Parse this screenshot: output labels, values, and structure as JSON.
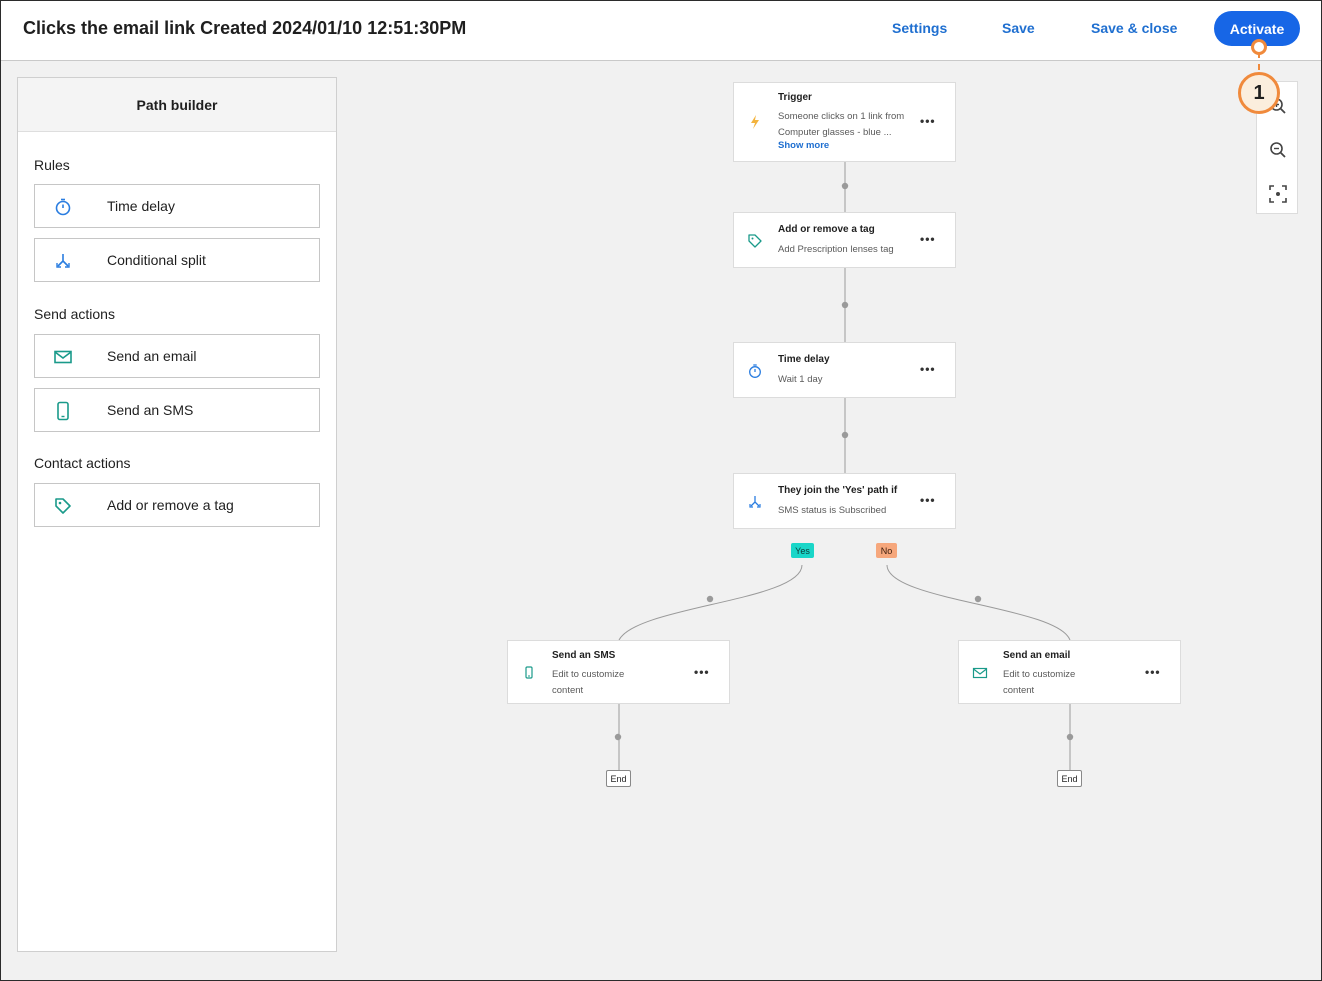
{
  "header": {
    "title": "Clicks the email link Created 2024/01/10 12:51:30PM",
    "settings_label": "Settings",
    "save_label": "Save",
    "save_close_label": "Save & close",
    "activate_label": "Activate"
  },
  "sidebar": {
    "heading": "Path builder",
    "sections": {
      "rules": "Rules",
      "send_actions": "Send actions",
      "contact_actions": "Contact actions"
    },
    "items": {
      "time_delay": "Time delay",
      "conditional_split": "Conditional split",
      "send_email": "Send an email",
      "send_sms": "Send an SMS",
      "add_tag": "Add or remove a tag"
    }
  },
  "flow": {
    "trigger": {
      "title": "Trigger",
      "desc": "Someone clicks on 1 link from Computer glasses - blue ...",
      "show_more": "Show more"
    },
    "tag": {
      "title": "Add or remove a tag",
      "desc": "Add Prescription lenses tag"
    },
    "delay": {
      "title": "Time delay",
      "desc": "Wait 1 day"
    },
    "split": {
      "title": "They join the 'Yes' path if",
      "desc": "SMS status is Subscribed"
    },
    "yes_label": "Yes",
    "no_label": "No",
    "sms": {
      "title": "Send an SMS",
      "desc": "Edit to customize content"
    },
    "email": {
      "title": "Send an email",
      "desc": "Edit to customize content"
    },
    "end_label": "End",
    "more_label": "•••"
  },
  "callout": {
    "number": "1"
  },
  "colors": {
    "primary": "#1766e6",
    "link": "#1f6fd0",
    "teal_icon": "#1a9a8a",
    "blue_icon": "#2a7de0",
    "trigger_icon": "#f3b33d",
    "yes_pill": "#1ad6c8",
    "no_pill": "#f6a77c",
    "callout": "#f08a3c"
  },
  "icons": {
    "trigger": "lightning-icon",
    "tag": "tag-icon",
    "delay": "stopwatch-icon",
    "split": "split-arrows-icon",
    "sms": "phone-icon",
    "email": "envelope-icon",
    "zoom_in": "zoom-in-icon",
    "zoom_out": "zoom-out-icon",
    "fit": "fit-screen-icon"
  }
}
